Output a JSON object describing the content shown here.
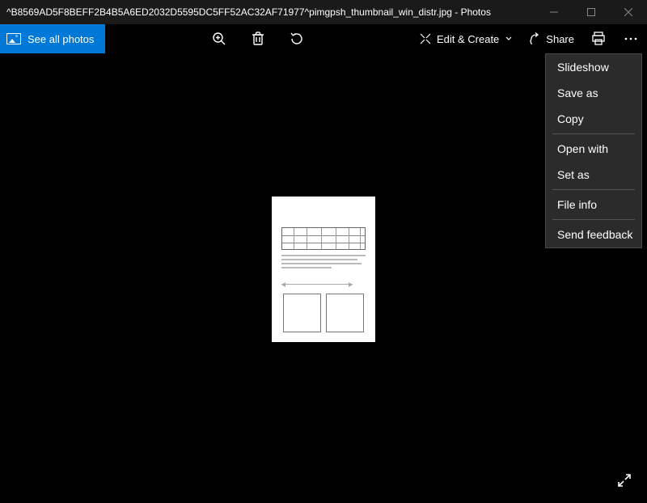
{
  "titlebar": {
    "title": "^B8569AD5F8BEFF2B4B5A6ED2032D5595DC5FF52AC32AF71977^pimgpsh_thumbnail_win_distr.jpg - Photos"
  },
  "toolbar": {
    "see_all_label": "See all photos",
    "edit_create_label": "Edit & Create",
    "share_label": "Share"
  },
  "menu": {
    "items": [
      {
        "label": "Slideshow"
      },
      {
        "label": "Save as"
      },
      {
        "label": "Copy"
      },
      {
        "sep": true
      },
      {
        "label": "Open with"
      },
      {
        "label": "Set as"
      },
      {
        "sep": true
      },
      {
        "label": "File info"
      },
      {
        "sep": true
      },
      {
        "label": "Send feedback"
      }
    ]
  }
}
